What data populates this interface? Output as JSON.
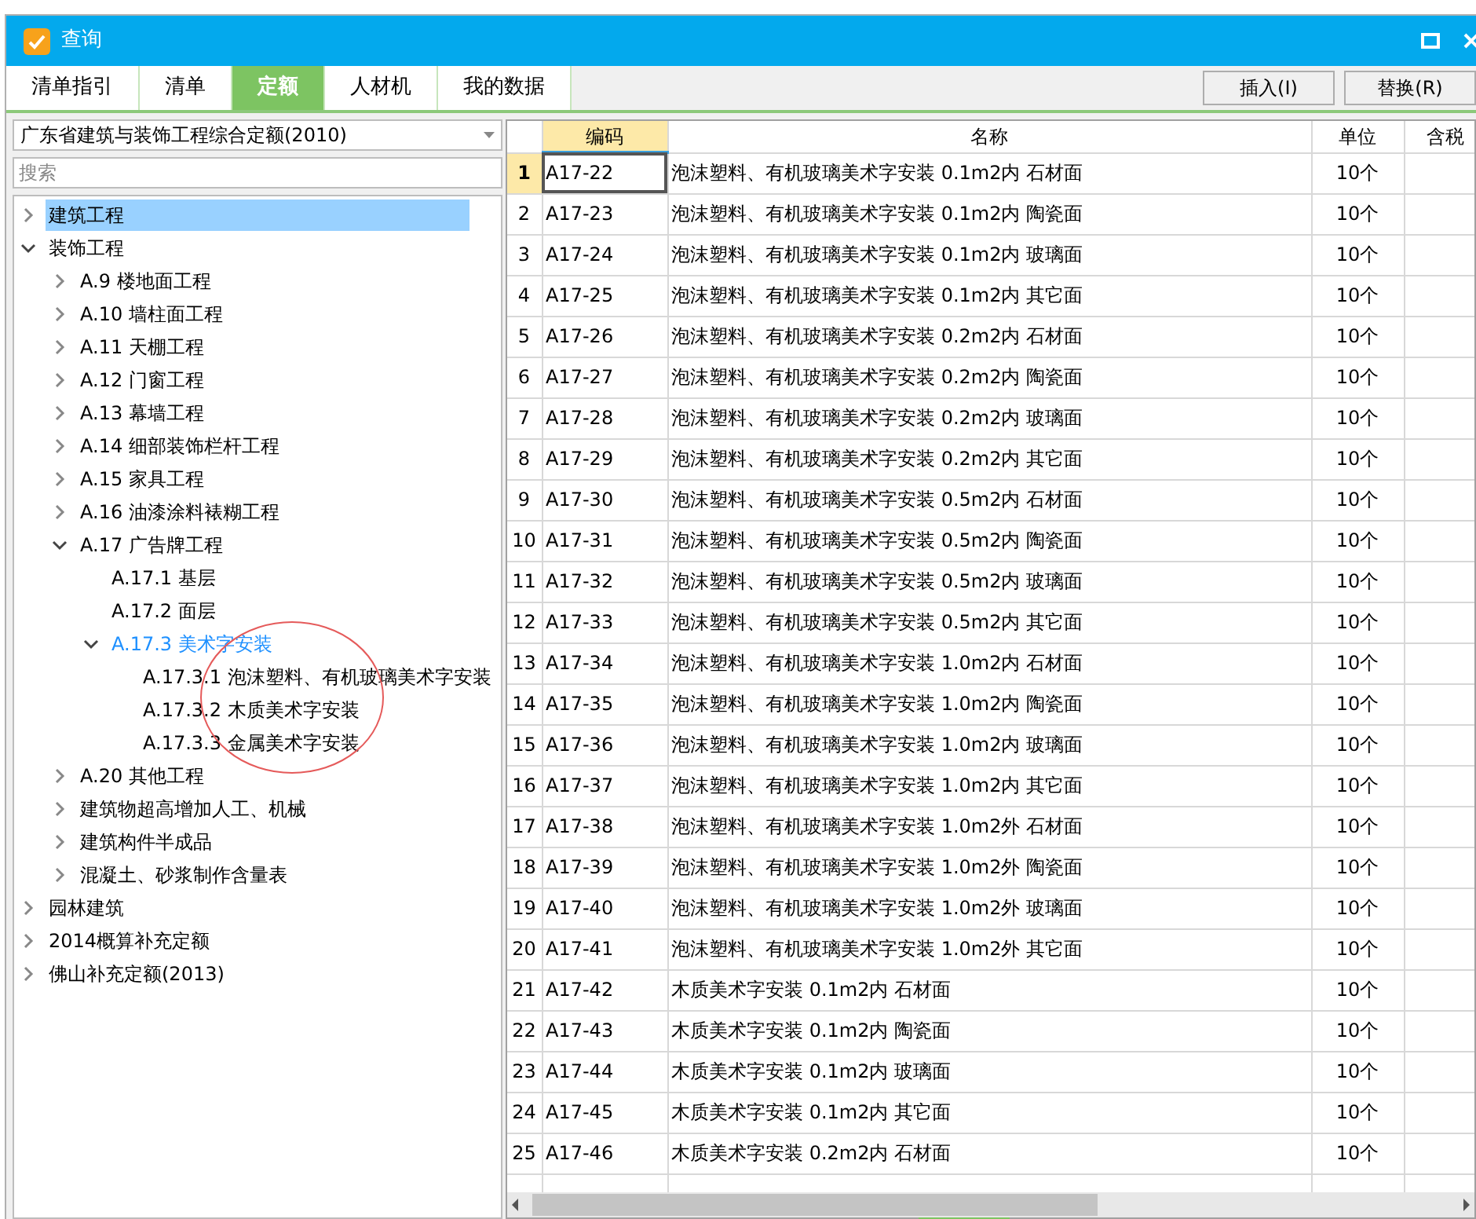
{
  "window": {
    "title": "查询"
  },
  "tabs": [
    {
      "label": "清单指引",
      "selected": false
    },
    {
      "label": "清单",
      "selected": false
    },
    {
      "label": "定额",
      "selected": true
    },
    {
      "label": "人材机",
      "selected": false
    },
    {
      "label": "我的数据",
      "selected": false
    }
  ],
  "buttons": [
    "插入(I)",
    "替换(R)"
  ],
  "library_select": {
    "value": "广东省建筑与装饰工程综合定额(2010)"
  },
  "search": {
    "placeholder": "搜索"
  },
  "tree": [
    {
      "label": "建筑工程",
      "expanded": false,
      "selected": true,
      "highlighted": false
    },
    {
      "label": "装饰工程",
      "expanded": true,
      "selected": false,
      "highlighted": false,
      "children": [
        {
          "label": "A.9 楼地面工程",
          "expanded": false,
          "selected": false,
          "highlighted": false
        },
        {
          "label": "A.10 墙柱面工程",
          "expanded": false,
          "selected": false,
          "highlighted": false
        },
        {
          "label": "A.11 天棚工程",
          "expanded": false,
          "selected": false,
          "highlighted": false
        },
        {
          "label": "A.12 门窗工程",
          "expanded": false,
          "selected": false,
          "highlighted": false
        },
        {
          "label": "A.13 幕墙工程",
          "expanded": false,
          "selected": false,
          "highlighted": false
        },
        {
          "label": "A.14 细部装饰栏杆工程",
          "expanded": false,
          "selected": false,
          "highlighted": false
        },
        {
          "label": "A.15 家具工程",
          "expanded": false,
          "selected": false,
          "highlighted": false
        },
        {
          "label": "A.16 油漆涂料裱糊工程",
          "expanded": false,
          "selected": false,
          "highlighted": false
        },
        {
          "label": "A.17 广告牌工程",
          "expanded": true,
          "selected": false,
          "highlighted": false,
          "children": [
            {
              "label": "A.17.1 基层",
              "selected": false,
              "highlighted": false
            },
            {
              "label": "A.17.2 面层",
              "selected": false,
              "highlighted": false
            },
            {
              "label": "A.17.3 美术字安装",
              "expanded": true,
              "selected": false,
              "highlighted": true,
              "children": [
                {
                  "label": "A.17.3.1 泡沫塑料、有机玻璃美术字安装",
                  "selected": false,
                  "highlighted": false
                },
                {
                  "label": "A.17.3.2 木质美术字安装",
                  "selected": false,
                  "highlighted": false
                },
                {
                  "label": "A.17.3.3 金属美术字安装",
                  "selected": false,
                  "highlighted": false
                }
              ]
            }
          ]
        },
        {
          "label": "A.20 其他工程",
          "expanded": false,
          "selected": false,
          "highlighted": false
        },
        {
          "label": "建筑物超高增加人工、机械",
          "expanded": false,
          "selected": false,
          "highlighted": false
        },
        {
          "label": "建筑构件半成品",
          "expanded": false,
          "selected": false,
          "highlighted": false
        },
        {
          "label": "混凝土、砂浆制作含量表",
          "expanded": false,
          "selected": false,
          "highlighted": false
        }
      ]
    },
    {
      "label": "园林建筑",
      "expanded": false,
      "selected": false,
      "highlighted": false
    },
    {
      "label": "2014概算补充定额",
      "expanded": false,
      "selected": false,
      "highlighted": false
    },
    {
      "label": "佛山补充定额(2013)",
      "expanded": false,
      "selected": false,
      "highlighted": false
    }
  ],
  "table": {
    "columns": [
      "编码",
      "名称",
      "单位",
      "含税"
    ],
    "rows": [
      {
        "number": "1",
        "code": "A17-22",
        "name": "泡沫塑料、有机玻璃美术字安装 0.1m2内 石材面",
        "unit": "10个",
        "selected": true
      },
      {
        "number": "2",
        "code": "A17-23",
        "name": "泡沫塑料、有机玻璃美术字安装 0.1m2内 陶瓷面",
        "unit": "10个",
        "selected": false
      },
      {
        "number": "3",
        "code": "A17-24",
        "name": "泡沫塑料、有机玻璃美术字安装 0.1m2内 玻璃面",
        "unit": "10个",
        "selected": false
      },
      {
        "number": "4",
        "code": "A17-25",
        "name": "泡沫塑料、有机玻璃美术字安装 0.1m2内 其它面",
        "unit": "10个",
        "selected": false
      },
      {
        "number": "5",
        "code": "A17-26",
        "name": "泡沫塑料、有机玻璃美术字安装 0.2m2内 石材面",
        "unit": "10个",
        "selected": false
      },
      {
        "number": "6",
        "code": "A17-27",
        "name": "泡沫塑料、有机玻璃美术字安装 0.2m2内 陶瓷面",
        "unit": "10个",
        "selected": false
      },
      {
        "number": "7",
        "code": "A17-28",
        "name": "泡沫塑料、有机玻璃美术字安装 0.2m2内 玻璃面",
        "unit": "10个",
        "selected": false
      },
      {
        "number": "8",
        "code": "A17-29",
        "name": "泡沫塑料、有机玻璃美术字安装 0.2m2内 其它面",
        "unit": "10个",
        "selected": false
      },
      {
        "number": "9",
        "code": "A17-30",
        "name": "泡沫塑料、有机玻璃美术字安装 0.5m2内 石材面",
        "unit": "10个",
        "selected": false
      },
      {
        "number": "10",
        "code": "A17-31",
        "name": "泡沫塑料、有机玻璃美术字安装 0.5m2内 陶瓷面",
        "unit": "10个",
        "selected": false
      },
      {
        "number": "11",
        "code": "A17-32",
        "name": "泡沫塑料、有机玻璃美术字安装 0.5m2内 玻璃面",
        "unit": "10个",
        "selected": false
      },
      {
        "number": "12",
        "code": "A17-33",
        "name": "泡沫塑料、有机玻璃美术字安装 0.5m2内 其它面",
        "unit": "10个",
        "selected": false
      },
      {
        "number": "13",
        "code": "A17-34",
        "name": "泡沫塑料、有机玻璃美术字安装 1.0m2内 石材面",
        "unit": "10个",
        "selected": false
      },
      {
        "number": "14",
        "code": "A17-35",
        "name": "泡沫塑料、有机玻璃美术字安装 1.0m2内 陶瓷面",
        "unit": "10个",
        "selected": false
      },
      {
        "number": "15",
        "code": "A17-36",
        "name": "泡沫塑料、有机玻璃美术字安装 1.0m2内 玻璃面",
        "unit": "10个",
        "selected": false
      },
      {
        "number": "16",
        "code": "A17-37",
        "name": "泡沫塑料、有机玻璃美术字安装 1.0m2内 其它面",
        "unit": "10个",
        "selected": false
      },
      {
        "number": "17",
        "code": "A17-38",
        "name": "泡沫塑料、有机玻璃美术字安装 1.0m2外 石材面",
        "unit": "10个",
        "selected": false
      },
      {
        "number": "18",
        "code": "A17-39",
        "name": "泡沫塑料、有机玻璃美术字安装 1.0m2外 陶瓷面",
        "unit": "10个",
        "selected": false
      },
      {
        "number": "19",
        "code": "A17-40",
        "name": "泡沫塑料、有机玻璃美术字安装 1.0m2外 玻璃面",
        "unit": "10个",
        "selected": false
      },
      {
        "number": "20",
        "code": "A17-41",
        "name": "泡沫塑料、有机玻璃美术字安装 1.0m2外 其它面",
        "unit": "10个",
        "selected": false
      },
      {
        "number": "21",
        "code": "A17-42",
        "name": "木质美术字安装 0.1m2内 石材面",
        "unit": "10个",
        "selected": false
      },
      {
        "number": "22",
        "code": "A17-43",
        "name": "木质美术字安装 0.1m2内 陶瓷面",
        "unit": "10个",
        "selected": false
      },
      {
        "number": "23",
        "code": "A17-44",
        "name": "木质美术字安装 0.1m2内 玻璃面",
        "unit": "10个",
        "selected": false
      },
      {
        "number": "24",
        "code": "A17-45",
        "name": "木质美术字安装 0.1m2内 其它面",
        "unit": "10个",
        "selected": false
      },
      {
        "number": "25",
        "code": "A17-46",
        "name": "木质美术字安装 0.2m2内 石材面",
        "unit": "10个",
        "selected": false
      }
    ]
  }
}
